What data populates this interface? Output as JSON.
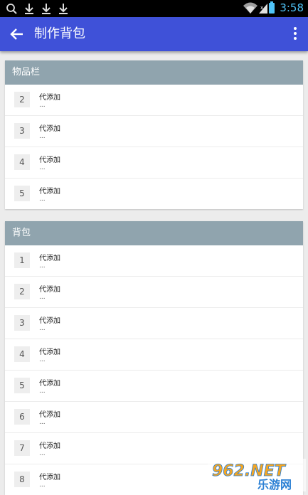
{
  "status_bar": {
    "time": "3:58",
    "left_icons": [
      "search-icon",
      "download-icon",
      "download-icon",
      "download-icon"
    ],
    "right_icons": [
      "wifi-icon",
      "signal-icon",
      "battery-icon"
    ]
  },
  "app_bar": {
    "title": "制作背包",
    "back_icon": "arrow-left-icon",
    "more_icon": "more-vert-icon",
    "color": "#3f51d8"
  },
  "sections": [
    {
      "title": "物品栏",
      "rows": [
        {
          "slot": "2",
          "name": "代添加",
          "sub": "..."
        },
        {
          "slot": "3",
          "name": "代添加",
          "sub": "..."
        },
        {
          "slot": "4",
          "name": "代添加",
          "sub": "..."
        },
        {
          "slot": "5",
          "name": "代添加",
          "sub": "..."
        }
      ]
    },
    {
      "title": "背包",
      "rows": [
        {
          "slot": "1",
          "name": "代添加",
          "sub": "..."
        },
        {
          "slot": "2",
          "name": "代添加",
          "sub": "..."
        },
        {
          "slot": "3",
          "name": "代添加",
          "sub": "..."
        },
        {
          "slot": "4",
          "name": "代添加",
          "sub": "..."
        },
        {
          "slot": "5",
          "name": "代添加",
          "sub": "..."
        },
        {
          "slot": "6",
          "name": "代添加",
          "sub": "..."
        },
        {
          "slot": "7",
          "name": "代添加",
          "sub": "..."
        },
        {
          "slot": "8",
          "name": "代添加",
          "sub": "..."
        }
      ]
    }
  ],
  "header_color": "#90a4ae",
  "watermark": {
    "line1": "962.NET",
    "line2": "乐游网"
  }
}
